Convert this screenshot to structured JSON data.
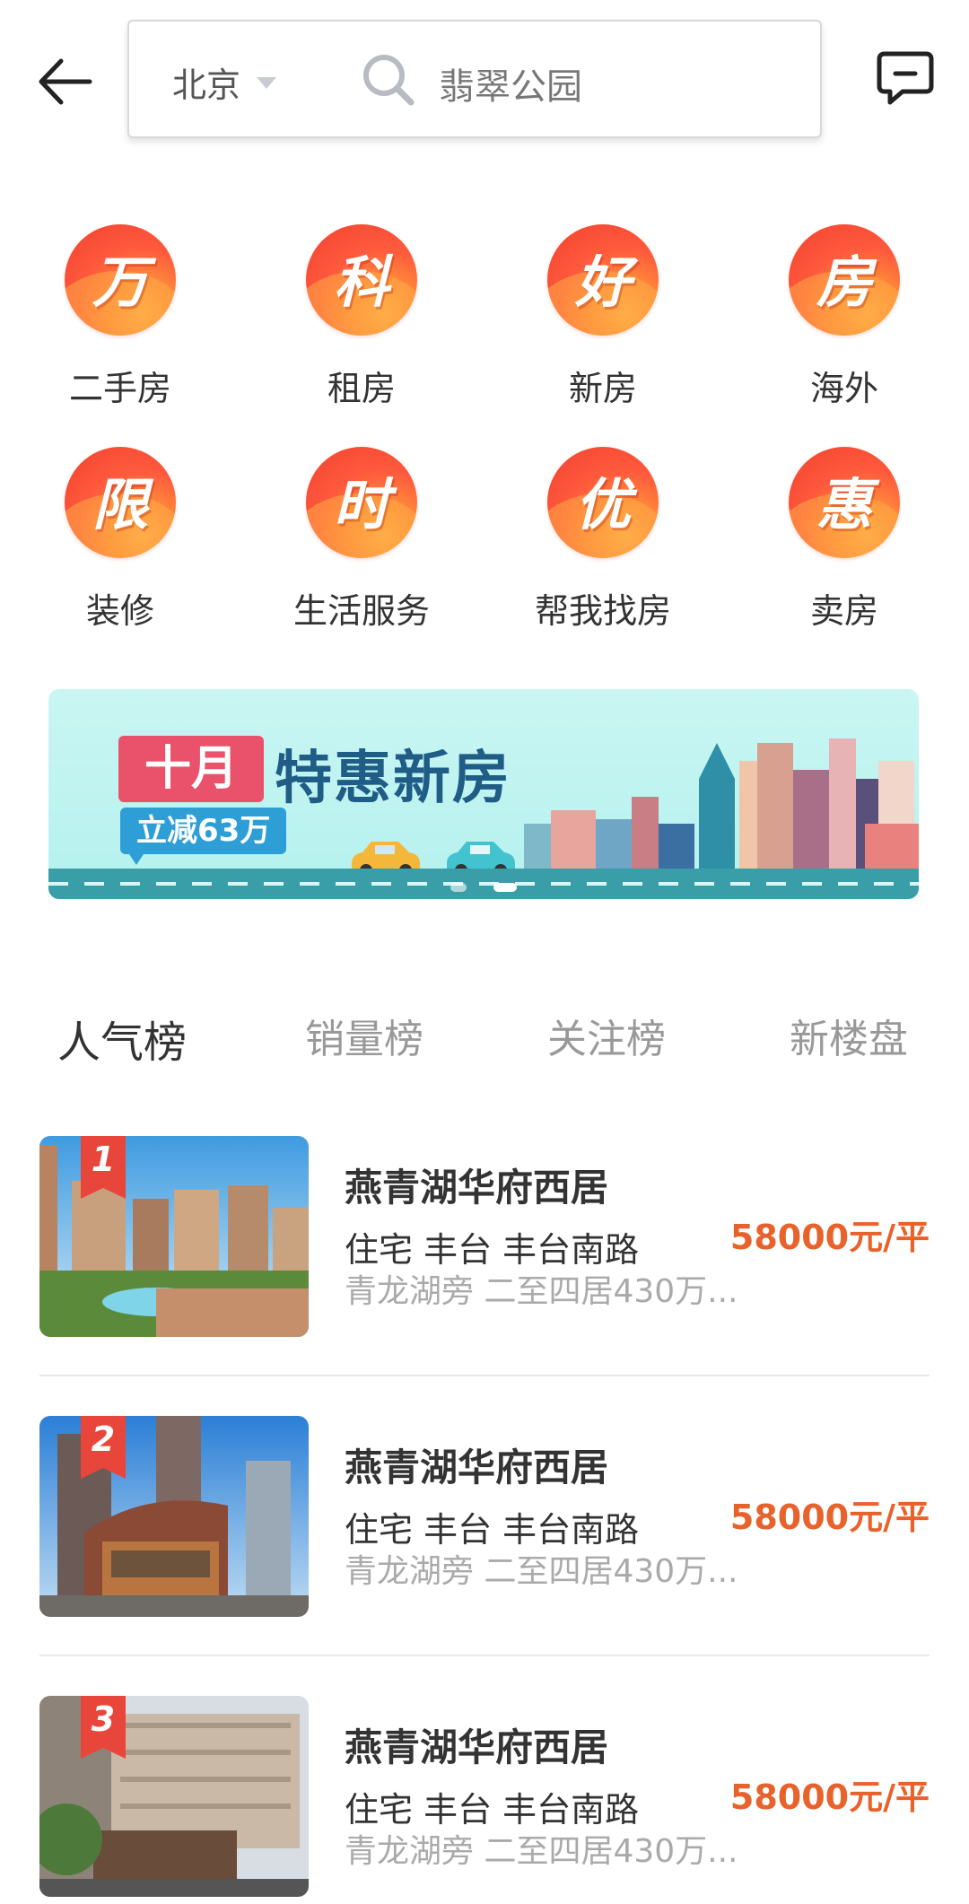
{
  "header": {
    "city": "北京",
    "search_text": "翡翠公园"
  },
  "categories": [
    {
      "glyph": "万",
      "label": "二手房"
    },
    {
      "glyph": "科",
      "label": "租房"
    },
    {
      "glyph": "好",
      "label": "新房"
    },
    {
      "glyph": "房",
      "label": "海外"
    },
    {
      "glyph": "限",
      "label": "装修"
    },
    {
      "glyph": "时",
      "label": "生活服务"
    },
    {
      "glyph": "优",
      "label": "帮我找房"
    },
    {
      "glyph": "惠",
      "label": "卖房"
    }
  ],
  "banner": {
    "tag": "十月",
    "title": "特惠新房",
    "subtitle": "立减63万"
  },
  "tabs": [
    "人气榜",
    "销量榜",
    "关注榜",
    "新楼盘"
  ],
  "listings": [
    {
      "rank": "1",
      "title": "燕青湖华府西居",
      "subtitle": "住宅 丰台 丰台南路",
      "desc": "青龙湖旁 二至四居430万...",
      "price": "58000元/平"
    },
    {
      "rank": "2",
      "title": "燕青湖华府西居",
      "subtitle": "住宅 丰台 丰台南路",
      "desc": "青龙湖旁 二至四居430万...",
      "price": "58000元/平"
    },
    {
      "rank": "3",
      "title": "燕青湖华府西居",
      "subtitle": "住宅 丰台 丰台南路",
      "desc": "青龙湖旁 二至四居430万...",
      "price": "58000元/平"
    }
  ],
  "colors": {
    "accent_orange": "#e8622c",
    "rank_red": "#e8463b",
    "banner_bg": "#b4f1ee"
  }
}
